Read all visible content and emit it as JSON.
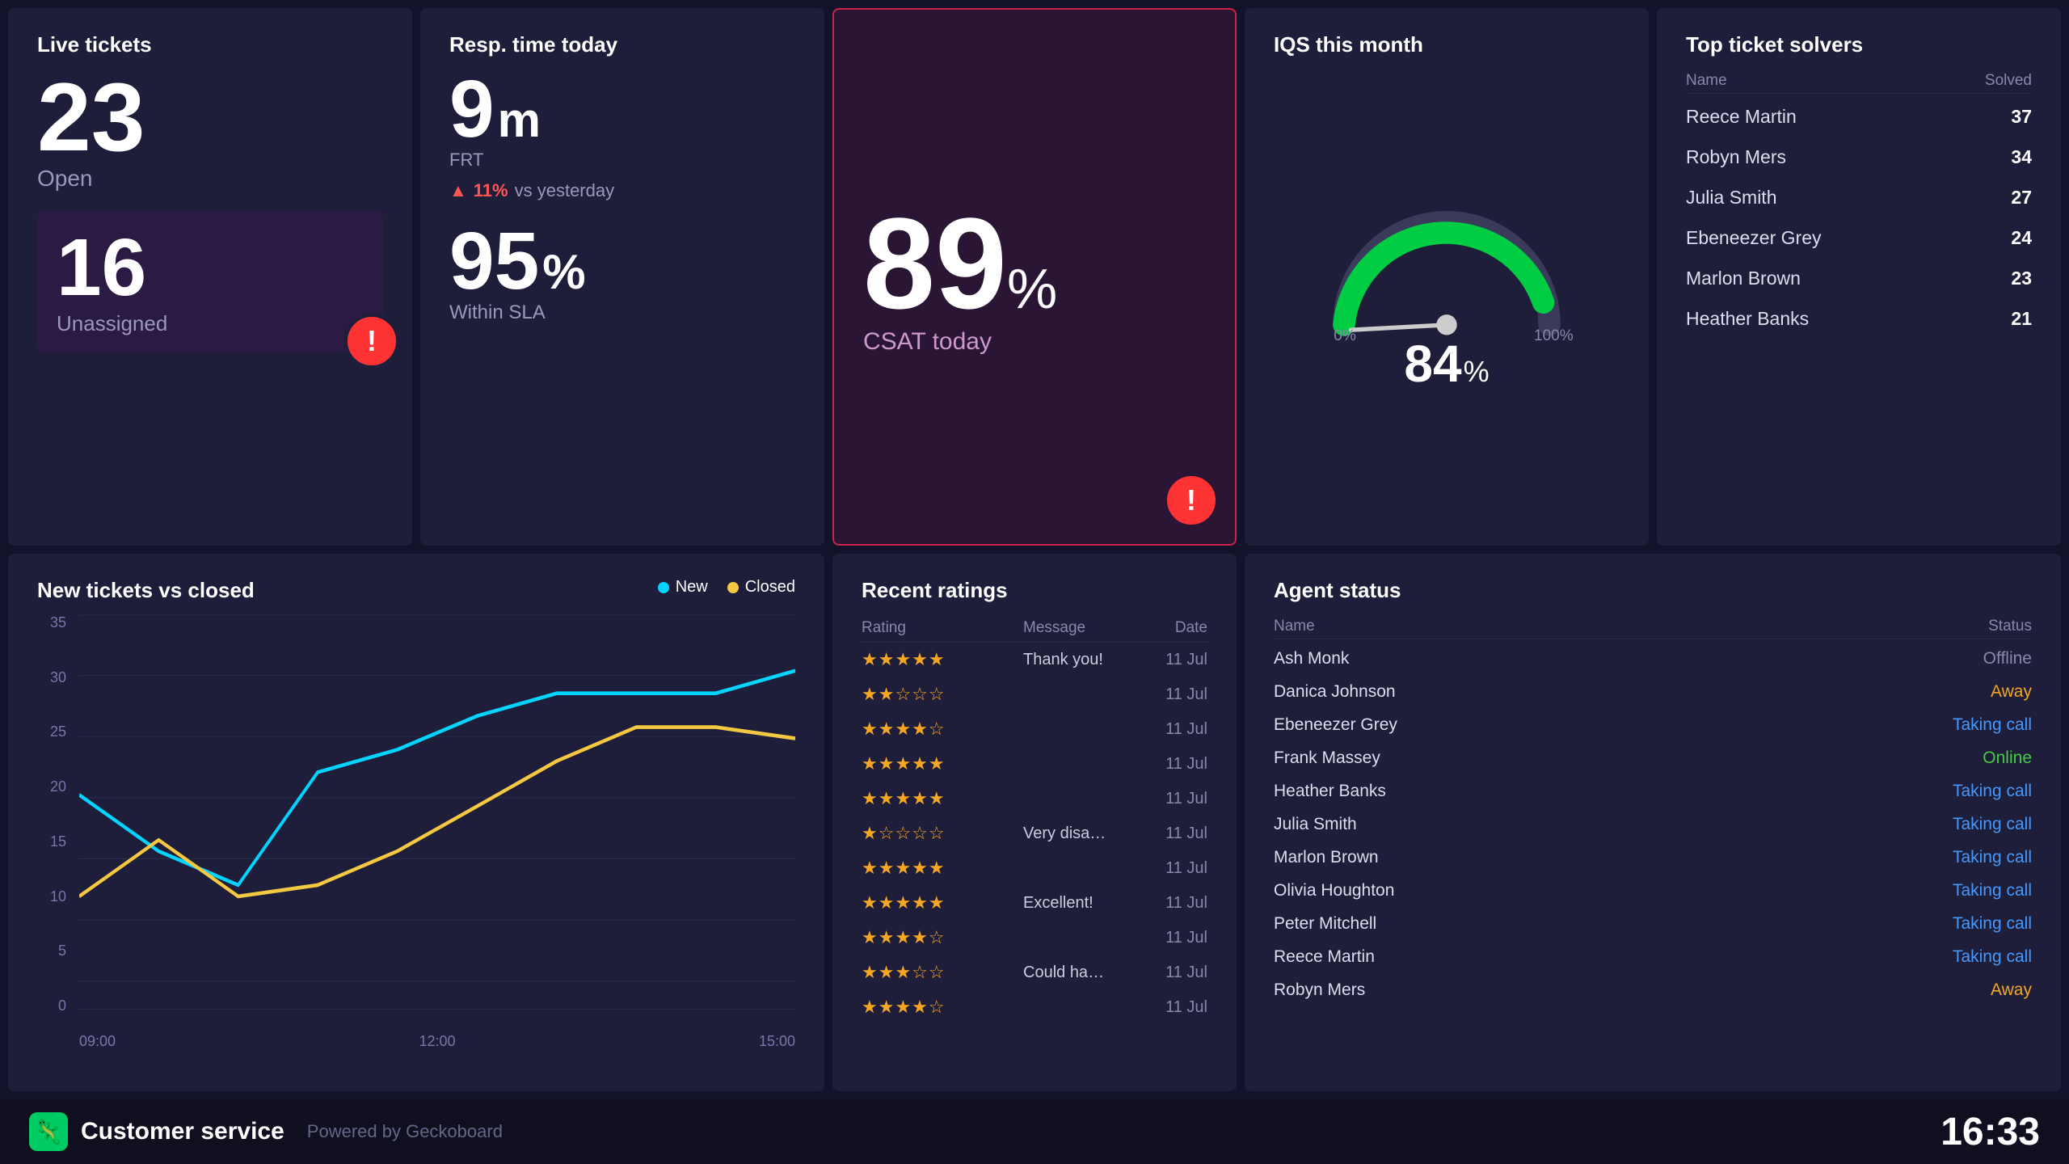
{
  "header": {},
  "liveTickets": {
    "title": "Live tickets",
    "openNumber": "23",
    "openLabel": "Open",
    "unassignedNumber": "16",
    "unassignedLabel": "Unassigned"
  },
  "respTime": {
    "title": "Resp. time today",
    "frtValue": "9",
    "frtUnit": "m",
    "frtLabel": "FRT",
    "changePercent": "11%",
    "changeVs": "vs yesterday",
    "slaValue": "95",
    "slaUnit": "%",
    "slaLabel": "Within SLA"
  },
  "csat": {
    "value": "89",
    "unit": "%",
    "label": "CSAT today"
  },
  "iqs": {
    "title": "IQS this month",
    "value": "84",
    "unit": "%",
    "minLabel": "0%",
    "maxLabel": "100%"
  },
  "topSolvers": {
    "title": "Top ticket solvers",
    "colName": "Name",
    "colSolved": "Solved",
    "rows": [
      {
        "name": "Reece Martin",
        "count": "37"
      },
      {
        "name": "Robyn Mers",
        "count": "34"
      },
      {
        "name": "Julia Smith",
        "count": "27"
      },
      {
        "name": "Ebeneezer Grey",
        "count": "24"
      },
      {
        "name": "Marlon Brown",
        "count": "23"
      },
      {
        "name": "Heather Banks",
        "count": "21"
      }
    ]
  },
  "chart": {
    "title": "New tickets vs closed",
    "legendNew": "New",
    "legendClosed": "Closed",
    "yLabels": [
      "35",
      "30",
      "25",
      "20",
      "15",
      "10",
      "5",
      "0"
    ],
    "xLabels": [
      "09:00",
      "12:00",
      "15:00"
    ],
    "newData": [
      19,
      14,
      11,
      21,
      23,
      26,
      28,
      28,
      28,
      30
    ],
    "closedData": [
      10,
      15,
      10,
      11,
      14,
      18,
      22,
      25,
      25,
      24
    ]
  },
  "ratings": {
    "title": "Recent ratings",
    "colRating": "Rating",
    "colMessage": "Message",
    "colDate": "Date",
    "rows": [
      {
        "stars": 5,
        "message": "Thank you!",
        "date": "11 Jul"
      },
      {
        "stars": 2,
        "message": "",
        "date": "11 Jul"
      },
      {
        "stars": 4,
        "message": "",
        "date": "11 Jul"
      },
      {
        "stars": 5,
        "message": "",
        "date": "11 Jul"
      },
      {
        "stars": 5,
        "message": "",
        "date": "11 Jul"
      },
      {
        "stars": 1,
        "message": "Very disappointed with service",
        "date": "11 Jul"
      },
      {
        "stars": 5,
        "message": "",
        "date": "11 Jul"
      },
      {
        "stars": 5,
        "message": "Excellent!",
        "date": "11 Jul"
      },
      {
        "stars": 4,
        "message": "",
        "date": "11 Jul"
      },
      {
        "stars": 3,
        "message": "Could have been quicker to re...",
        "date": "11 Jul"
      },
      {
        "stars": 4,
        "message": "",
        "date": "11 Jul"
      }
    ]
  },
  "agentStatus": {
    "title": "Agent status",
    "colName": "Name",
    "colStatus": "Status",
    "agents": [
      {
        "name": "Ash Monk",
        "status": "Offline",
        "statusClass": "offline"
      },
      {
        "name": "Danica Johnson",
        "status": "Away",
        "statusClass": "away"
      },
      {
        "name": "Ebeneezer Grey",
        "status": "Taking call",
        "statusClass": "call"
      },
      {
        "name": "Frank Massey",
        "status": "Online",
        "statusClass": "online"
      },
      {
        "name": "Heather Banks",
        "status": "Taking call",
        "statusClass": "call"
      },
      {
        "name": "Julia Smith",
        "status": "Taking call",
        "statusClass": "call"
      },
      {
        "name": "Marlon Brown",
        "status": "Taking call",
        "statusClass": "call"
      },
      {
        "name": "Olivia Houghton",
        "status": "Taking call",
        "statusClass": "call"
      },
      {
        "name": "Peter Mitchell",
        "status": "Taking call",
        "statusClass": "call"
      },
      {
        "name": "Reece Martin",
        "status": "Taking call",
        "statusClass": "call"
      },
      {
        "name": "Robyn Mers",
        "status": "Away",
        "statusClass": "away"
      }
    ]
  },
  "footer": {
    "appName": "Customer service",
    "poweredBy": "Powered by Geckoboard",
    "time": "16:33"
  },
  "colors": {
    "new": "#00d4ff",
    "closed": "#f5c842",
    "accent": "#cc2244",
    "green": "#00cc66"
  }
}
